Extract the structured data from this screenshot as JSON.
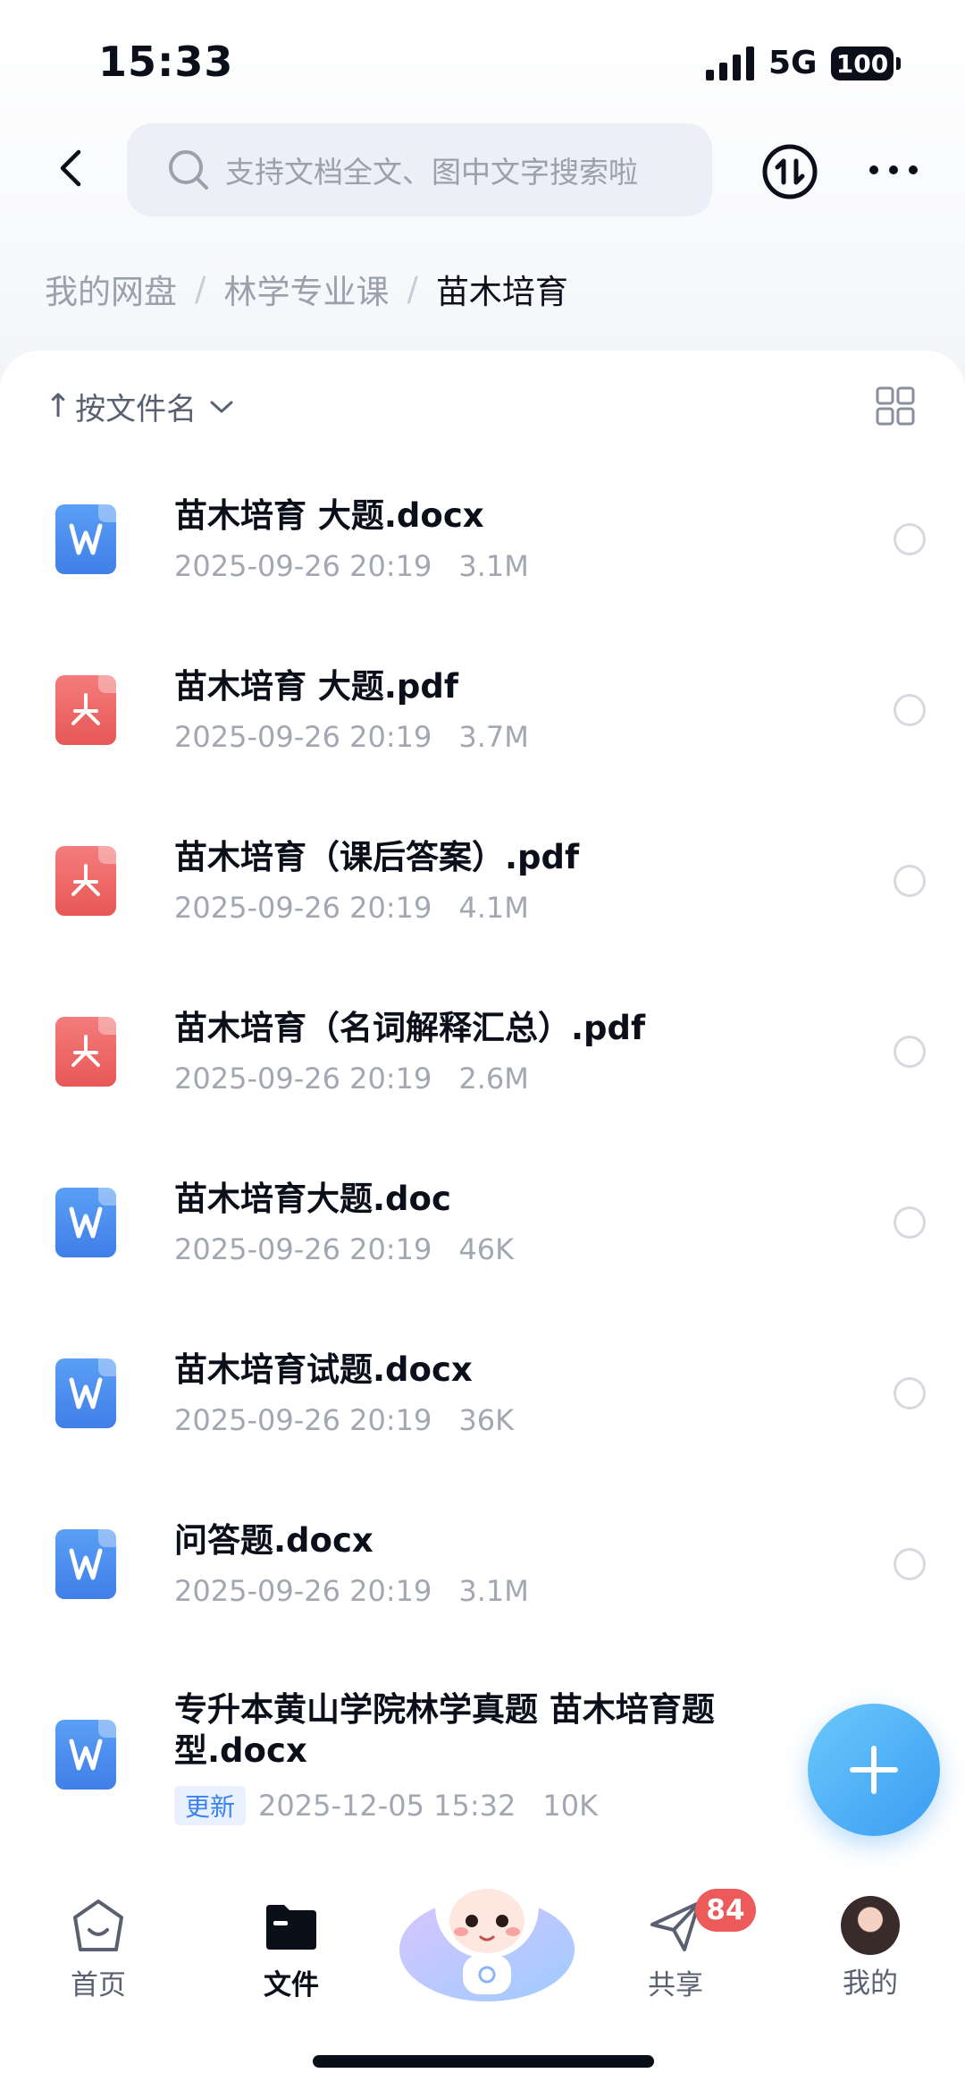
{
  "status_bar": {
    "time": "15:33",
    "network": "5G",
    "battery": "100"
  },
  "header": {
    "search_placeholder": "支持文档全文、图中文字搜索啦"
  },
  "breadcrumb": {
    "items": [
      "我的网盘",
      "林学专业课",
      "苗木培育"
    ],
    "separator": "/"
  },
  "sort": {
    "arrow": "↑",
    "label": "按文件名"
  },
  "files": [
    {
      "name": "苗木培育 大题.docx",
      "date": "2025-09-26 20:19",
      "size": "3.1M",
      "type": "word"
    },
    {
      "name": "苗木培育 大题.pdf",
      "date": "2025-09-26 20:19",
      "size": "3.7M",
      "type": "pdf"
    },
    {
      "name": "苗木培育（课后答案）.pdf",
      "date": "2025-09-26 20:19",
      "size": "4.1M",
      "type": "pdf"
    },
    {
      "name": "苗木培育（名词解释汇总）.pdf",
      "date": "2025-09-26 20:19",
      "size": "2.6M",
      "type": "pdf"
    },
    {
      "name": "苗木培育大题.doc",
      "date": "2025-09-26 20:19",
      "size": "46K",
      "type": "word"
    },
    {
      "name": "苗木培育试题.docx",
      "date": "2025-09-26 20:19",
      "size": "36K",
      "type": "word"
    },
    {
      "name": "问答题.docx",
      "date": "2025-09-26 20:19",
      "size": "3.1M",
      "type": "word"
    },
    {
      "name": "专升本黄山学院林学真题 苗木培育题型.docx",
      "badge": "更新",
      "date": "2025-12-05 15:32",
      "size": "10K",
      "type": "word"
    }
  ],
  "bottom_nav": {
    "home": "首页",
    "files": "文件",
    "share": "共享",
    "share_badge": "84",
    "mine": "我的"
  },
  "colors": {
    "accent": "#3a9cf2",
    "word": "#4a8ef0",
    "pdf": "#ec6464",
    "badge": "#ec5a5a"
  }
}
